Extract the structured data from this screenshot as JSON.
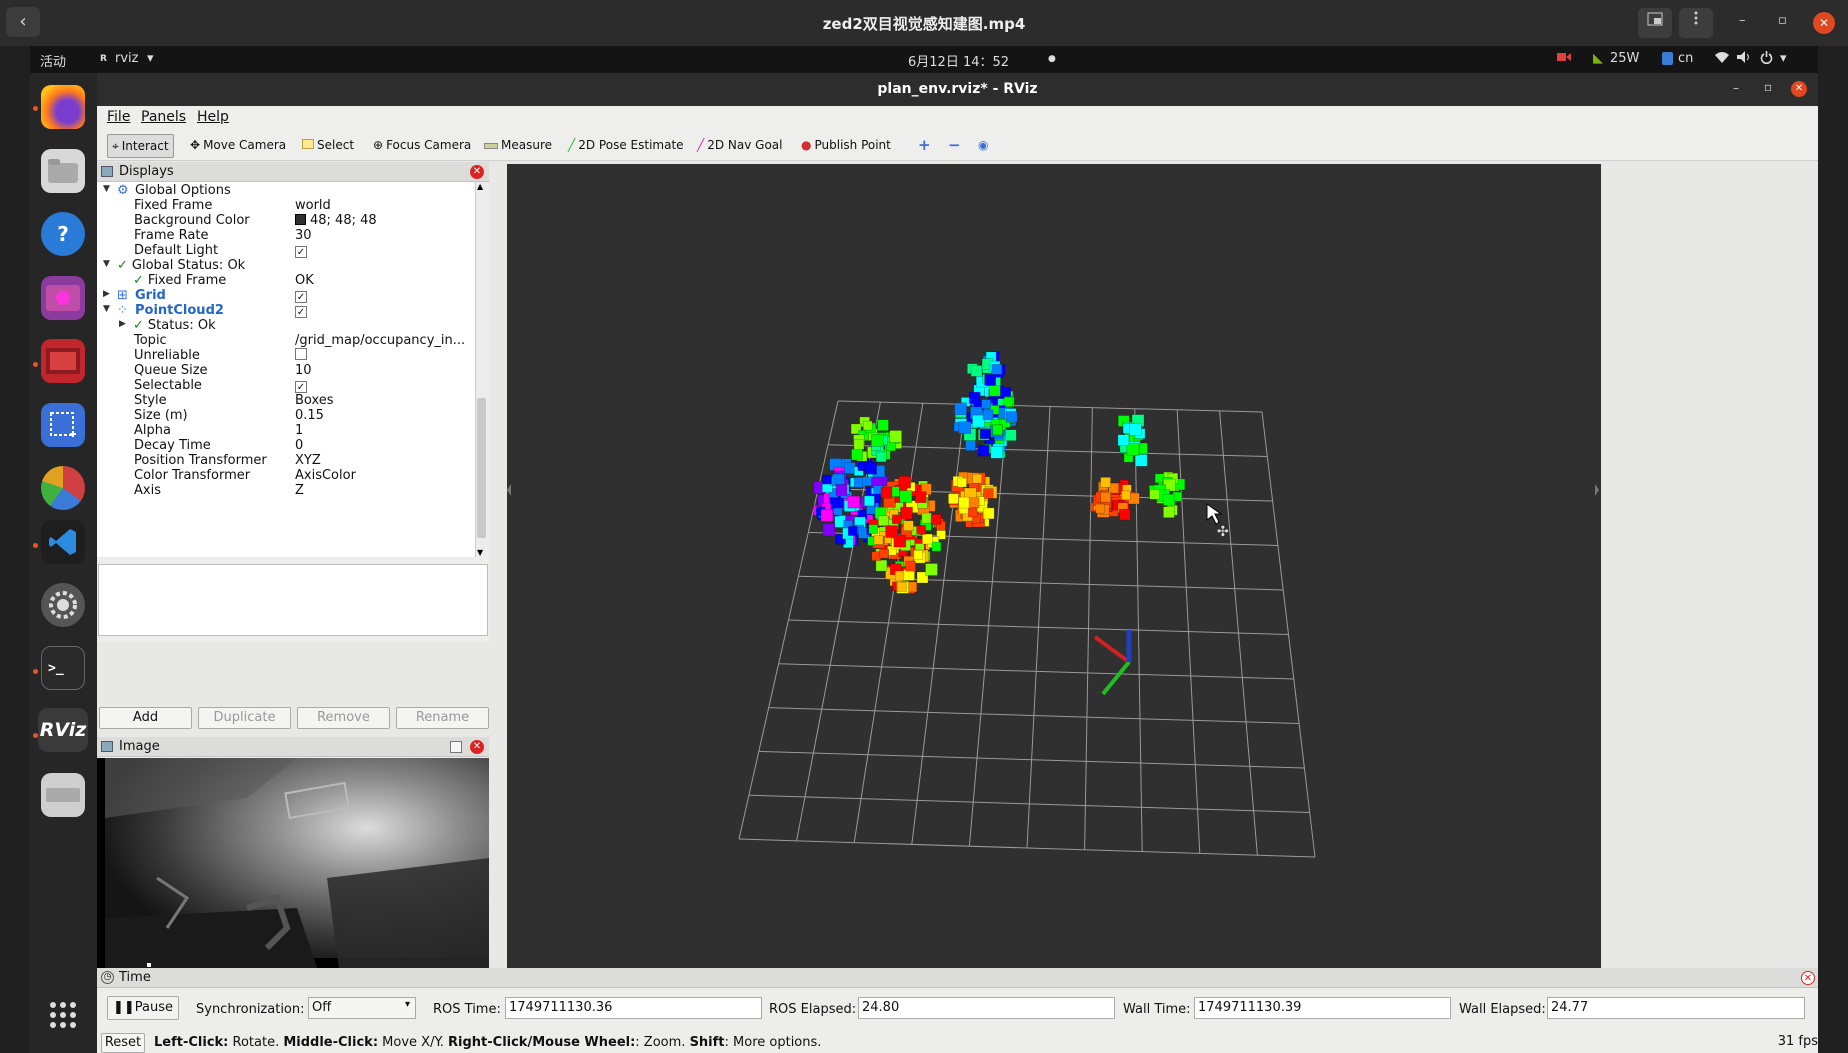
{
  "player": {
    "title": "zed2双目视觉感知建图.mp4",
    "back": "‹",
    "win_min": "–",
    "win_max": "▫",
    "win_close": "✕"
  },
  "gnome": {
    "activities": "活动",
    "app_name": "rviz",
    "app_arrow": "▾",
    "clock": "6月12日  14：52",
    "dot": "●",
    "power": "25W",
    "input": "cn",
    "sys_arrow": "▾"
  },
  "rviz": {
    "title": "plan_env.rviz* - RViz",
    "menus": [
      "File",
      "Panels",
      "Help"
    ],
    "tools": [
      "Interact",
      "Move Camera",
      "Select",
      "Focus Camera",
      "Measure",
      "2D Pose Estimate",
      "2D Nav Goal",
      "Publish Point"
    ]
  },
  "displays": {
    "title": "Displays",
    "rows": [
      {
        "key": "Global Options",
        "value": ""
      },
      {
        "key": "Fixed Frame",
        "value": "world"
      },
      {
        "key": "Background Color",
        "value": "48; 48; 48"
      },
      {
        "key": "Frame Rate",
        "value": "30"
      },
      {
        "key": "Default Light",
        "value": "✓"
      },
      {
        "key": "Global Status: Ok",
        "value": ""
      },
      {
        "key": "Fixed Frame",
        "value": "OK"
      },
      {
        "key": "Grid",
        "value": "✓"
      },
      {
        "key": "PointCloud2",
        "value": "✓"
      },
      {
        "key": "Status: Ok",
        "value": ""
      },
      {
        "key": "Topic",
        "value": "/grid_map/occupancy_in..."
      },
      {
        "key": "Unreliable",
        "value": ""
      },
      {
        "key": "Queue Size",
        "value": "10"
      },
      {
        "key": "Selectable",
        "value": "✓"
      },
      {
        "key": "Style",
        "value": "Boxes"
      },
      {
        "key": "Size (m)",
        "value": "0.15"
      },
      {
        "key": "Alpha",
        "value": "1"
      },
      {
        "key": "Decay Time",
        "value": "0"
      },
      {
        "key": "Position Transformer",
        "value": "XYZ"
      },
      {
        "key": "Color Transformer",
        "value": "AxisColor"
      },
      {
        "key": "Axis",
        "value": "Z"
      }
    ],
    "buttons": [
      "Add",
      "Duplicate",
      "Remove",
      "Rename"
    ]
  },
  "image_panel": {
    "title": "Image"
  },
  "time": {
    "title": "Time",
    "pause": "Pause",
    "sync_label": "Synchronization:",
    "sync_value": "Off",
    "ros_time_label": "ROS Time:",
    "ros_time": "1749711130.36",
    "ros_elapsed_label": "ROS Elapsed:",
    "ros_elapsed": "24.80",
    "wall_time_label": "Wall Time:",
    "wall_time": "1749711130.39",
    "wall_elapsed_label": "Wall Elapsed:",
    "wall_elapsed": "24.77"
  },
  "status": {
    "reset": "Reset",
    "h1": "Left-Click:",
    "t1": " Rotate. ",
    "h2": "Middle-Click:",
    "t2": " Move X/Y. ",
    "h3": "Right-Click/Mouse Wheel:",
    "t3": ": Zoom. ",
    "h4": "Shift",
    "t4": ": More options.",
    "fps": "31 fps"
  },
  "colors": {
    "viewport_bg": "#303030",
    "grid": "#a0a0a0",
    "accent": "#e95420"
  }
}
